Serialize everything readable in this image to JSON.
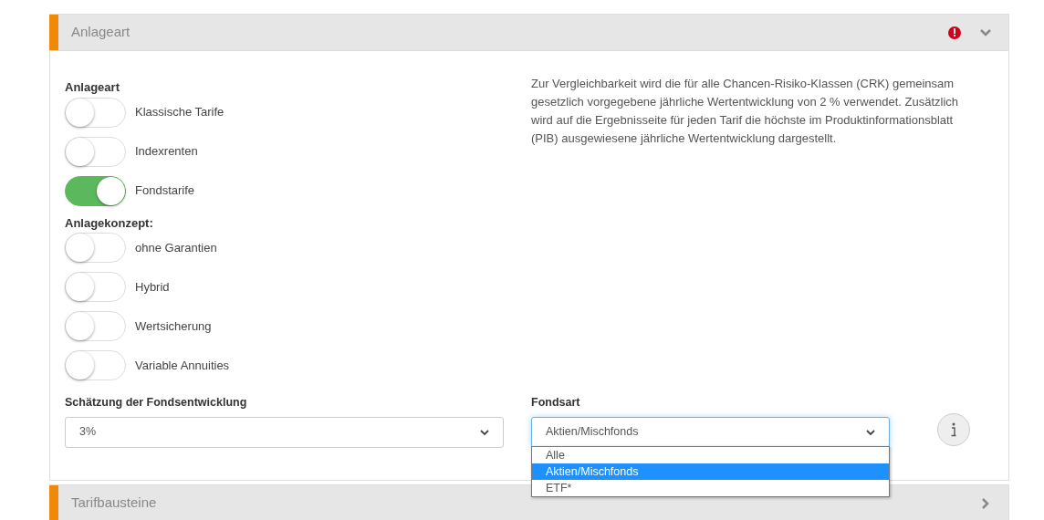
{
  "sections": [
    {
      "title": "Anlageart",
      "expanded": true,
      "warning": true
    },
    {
      "title": "Tarifbausteine",
      "expanded": false,
      "warning": false
    }
  ],
  "anlageart": {
    "heading": "Anlageart",
    "options": [
      {
        "label": "Klassische Tarife",
        "on": false
      },
      {
        "label": "Indexrenten",
        "on": false
      },
      {
        "label": "Fondstarife",
        "on": true
      }
    ]
  },
  "anlagekonzept": {
    "heading": "Anlagekonzept:",
    "options": [
      {
        "label": "ohne Garantien",
        "on": false
      },
      {
        "label": "Hybrid",
        "on": false
      },
      {
        "label": "Wertsicherung",
        "on": false
      },
      {
        "label": "Variable Annuities",
        "on": false
      }
    ]
  },
  "info_text": "Zur Vergleichbarkeit wird die für alle Chancen-Risiko-Klassen (CRK) gemeinsam gesetzlich vorgegebene jährliche Wertentwicklung von 2 % verwendet. Zusätzlich wird auf die Ergebnisseite für jeden Tarif die höchste im Produktinformationsblatt (PIB) ausgewiesene jährliche Wertentwicklung dargestellt.",
  "schaetzung": {
    "label": "Schätzung der Fondsentwicklung",
    "value": "3%"
  },
  "fondsart": {
    "label": "Fondsart",
    "value": "Aktien/Mischfonds",
    "expanded": true,
    "options": [
      {
        "label": "Alle",
        "selected": false
      },
      {
        "label": "Aktien/Mischfonds",
        "selected": true
      },
      {
        "label": "ETF*",
        "selected": false
      }
    ]
  }
}
